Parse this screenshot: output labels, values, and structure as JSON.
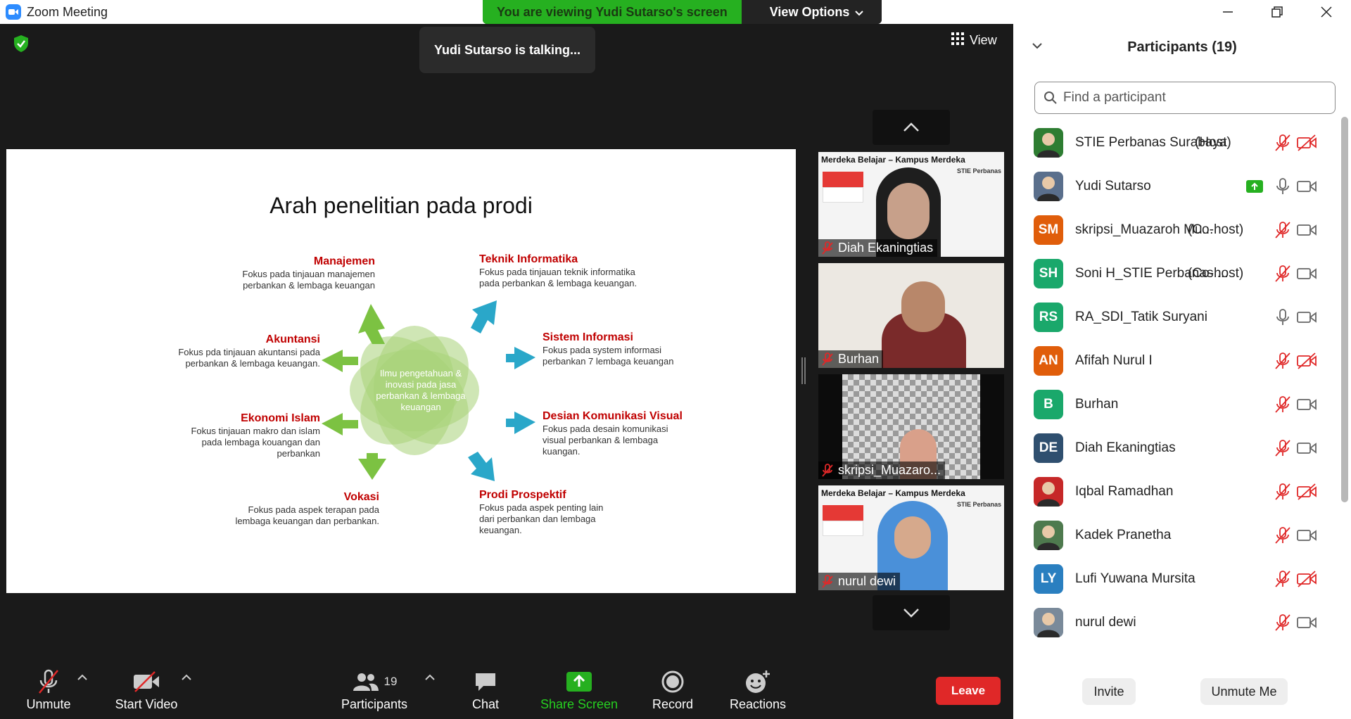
{
  "window": {
    "title": "Zoom Meeting"
  },
  "banner": {
    "text": "You are viewing Yudi Sutarso's screen",
    "options_label": "View Options"
  },
  "talking": "Yudi Sutarso is talking...",
  "view_label": "View",
  "slide": {
    "title": "Arah penelitian pada prodi",
    "center": "Ilmu pengetahuan & inovasi pada jasa perbankan & lembaga keuangan",
    "topics": [
      {
        "title": "Manajemen",
        "desc": "Fokus pada tinjauan manajemen perbankan & lembaga keuangan"
      },
      {
        "title": "Akuntansi",
        "desc": "Fokus pda tinjauan akuntansi pada perbankan & lembaga keuangan."
      },
      {
        "title": "Ekonomi Islam",
        "desc": "Fokus tinjauan makro dan islam pada lembaga kouangan dan perbankan"
      },
      {
        "title": "Vokasi",
        "desc": "Fokus pada aspek terapan pada lembaga keuangan dan perbankan."
      },
      {
        "title": "Teknik Informatika",
        "desc": "Fokus pada tinjauan teknik informatika pada perbankan & lembaga keuangan."
      },
      {
        "title": "Sistem Informasi",
        "desc": "Fokus pada system informasi perbankan 7 lembaga keuangan"
      },
      {
        "title": "Desian Komunikasi Visual",
        "desc": "Fokus pada desain komunikasi visual perbankan & lembaga kuangan."
      },
      {
        "title": "Prodi Prospektif",
        "desc": "Fokus pada aspek penting lain dari perbankan dan lembaga keuangan."
      }
    ]
  },
  "thumbnails": [
    {
      "name": "Diah Ekaningtias",
      "header": "Merdeka Belajar – Kampus Merdeka",
      "logo": "STIE Perbanas"
    },
    {
      "name": "Burhan"
    },
    {
      "name": "skripsi_Muazaro..."
    },
    {
      "name": "nurul dewi",
      "header": "Merdeka Belajar – Kampus Merdeka",
      "logo": "STIE Perbanas"
    }
  ],
  "toolbar": {
    "unmute": "Unmute",
    "start_video": "Start Video",
    "participants": "Participants",
    "participants_count": "19",
    "chat": "Chat",
    "share": "Share Screen",
    "record": "Record",
    "reactions": "Reactions",
    "leave": "Leave"
  },
  "panel": {
    "title": "Participants (19)",
    "search_placeholder": "Find a participant",
    "participants": [
      {
        "name": "STIE Perbanas Surabaya",
        "role": "(Host)",
        "initials": "",
        "color": "#2e7d32",
        "mic": "muted",
        "video": "off"
      },
      {
        "name": "Yudi Sutarso",
        "role": "",
        "initials": "",
        "color": "#5a6f8c",
        "mic": "on",
        "video": "on",
        "sharing": true
      },
      {
        "name": "skripsi_Muazaroh Mu...",
        "role": "(Co-host)",
        "initials": "SM",
        "color": "#e05d0a",
        "mic": "muted",
        "video": "on"
      },
      {
        "name": "Soni H_STIE Perbanas ...",
        "role": "(Co-host)",
        "initials": "SH",
        "color": "#1aa86b",
        "mic": "muted",
        "video": "on"
      },
      {
        "name": "RA_SDI_Tatik Suryani",
        "role": "",
        "initials": "RS",
        "color": "#1aa86b",
        "mic": "on",
        "video": "on"
      },
      {
        "name": "Afifah Nurul I",
        "role": "",
        "initials": "AN",
        "color": "#e05d0a",
        "mic": "muted",
        "video": "off"
      },
      {
        "name": "Burhan",
        "role": "",
        "initials": "B",
        "color": "#1aa86b",
        "mic": "muted",
        "video": "on"
      },
      {
        "name": "Diah Ekaningtias",
        "role": "",
        "initials": "DE",
        "color": "#2f4f6f",
        "mic": "muted",
        "video": "on"
      },
      {
        "name": "Iqbal Ramadhan",
        "role": "",
        "initials": "",
        "color": "#c62828",
        "mic": "muted",
        "video": "off"
      },
      {
        "name": "Kadek Pranetha",
        "role": "",
        "initials": "",
        "color": "#4e7a4e",
        "mic": "muted",
        "video": "on"
      },
      {
        "name": "Lufi Yuwana Mursita",
        "role": "",
        "initials": "LY",
        "color": "#2a7fc0",
        "mic": "muted",
        "video": "off"
      },
      {
        "name": "nurul dewi",
        "role": "",
        "initials": "",
        "color": "#7a8a9a",
        "mic": "muted",
        "video": "on"
      }
    ],
    "invite": "Invite",
    "unmute_me": "Unmute Me"
  },
  "colors": {
    "accent_green": "#26b020",
    "leave_red": "#e02828",
    "muted_red": "#e02828",
    "slide_heading_red": "#c00000"
  }
}
